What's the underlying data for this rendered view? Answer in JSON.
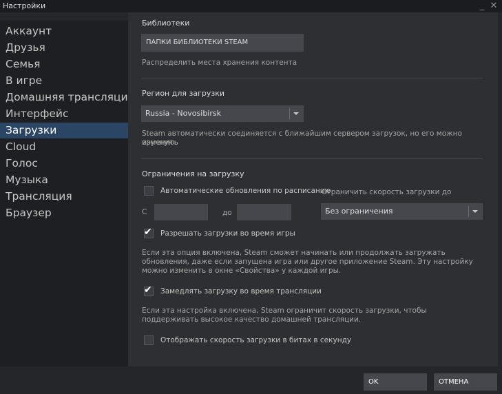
{
  "window": {
    "title": "Настройки",
    "minimize": "_",
    "close": "✕"
  },
  "sidebar": {
    "items": [
      {
        "label": "Аккаунт"
      },
      {
        "label": "Друзья"
      },
      {
        "label": "Семья"
      },
      {
        "label": "В игре"
      },
      {
        "label": "Домашняя трансляция"
      },
      {
        "label": "Интерфейс"
      },
      {
        "label": "Загрузки"
      },
      {
        "label": "Cloud"
      },
      {
        "label": "Голос"
      },
      {
        "label": "Музыка"
      },
      {
        "label": "Трансляция"
      },
      {
        "label": "Браузер"
      }
    ],
    "active_index": 6
  },
  "libraries": {
    "heading": "Библиотеки",
    "button": "ПАПКИ БИБЛИОТЕКИ STEAM",
    "description": "Распределить места хранения контента"
  },
  "region": {
    "heading": "Регион для загрузки",
    "selected": "Russia - Novosibirsk",
    "description_line1": "Steam автоматически соединяется с ближайшим сервером загрузок, но его можно изменить",
    "description_line2": "вручную."
  },
  "limits": {
    "heading": "Ограничения на загрузку",
    "auto_update_label": "Автоматические обновления по расписанию",
    "auto_update_checked": false,
    "from_label": "С",
    "to_label": "до",
    "from_value": "",
    "to_value": "",
    "speed_label": "Ограничить скорость загрузки до",
    "speed_selected": "Без ограничения",
    "allow_ingame_label": "Разрешать загрузки во время игры",
    "allow_ingame_checked": true,
    "allow_ingame_desc_line1": "Если эта опция включена, Steam сможет начинать или продолжать загружать",
    "allow_ingame_desc_line2": "обновления, даже если запущена игра или другое приложение Steam. Эту настройку",
    "allow_ingame_desc_line3": "можно изменить в окне «Свойства» у каждой игры.",
    "throttle_label": "Замедлять загрузку во время трансляции",
    "throttle_checked": true,
    "throttle_desc_line1": "Если эта настройка включена, Steam ограничит скорость загрузки, чтобы",
    "throttle_desc_line2": "поддерживать высокое качество домашней трансляции.",
    "bits_label": "Отображать скорость загрузки в битах в секунду",
    "bits_checked": false
  },
  "footer": {
    "ok": "OK",
    "cancel": "ОТМЕНА"
  },
  "check_glyph": "✔"
}
